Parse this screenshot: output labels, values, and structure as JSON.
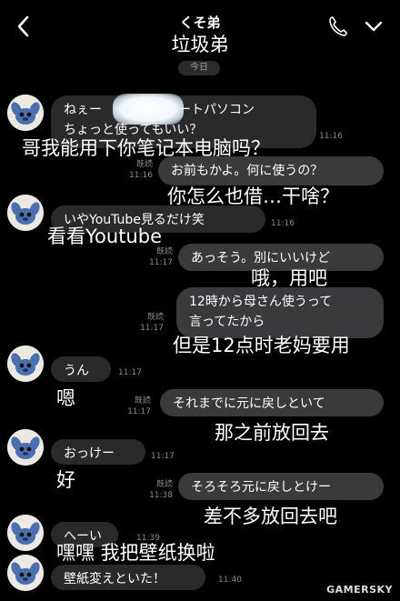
{
  "header": {
    "title": "くそ弟",
    "overlay_title": "垃圾弟"
  },
  "date_label": "今日",
  "messages": [
    {
      "side": "in",
      "lines": [
        "ねぇー　　　　のノートパソコン",
        "ちょっと使ってもいい？"
      ],
      "time": "11:16",
      "read": ""
    },
    {
      "side": "out",
      "lines": [
        "お前もかよ。何に使うの？"
      ],
      "time": "11:16",
      "read": "既読"
    },
    {
      "side": "in",
      "lines": [
        "いやYouTube見るだけ笑"
      ],
      "time": "11:16",
      "read": ""
    },
    {
      "side": "out",
      "lines": [
        "あっそう。別にいいけど"
      ],
      "time": "11:17",
      "read": "既読"
    },
    {
      "side": "out",
      "lines": [
        "12時から母さん使うって",
        "言ってたから"
      ],
      "time": "11:17",
      "read": "既読"
    },
    {
      "side": "in",
      "lines": [
        "うん"
      ],
      "time": "11:17",
      "read": ""
    },
    {
      "side": "out",
      "lines": [
        "それまでに元に戻しといて"
      ],
      "time": "11:17",
      "read": "既読"
    },
    {
      "side": "in",
      "lines": [
        "おっけー"
      ],
      "time": "11:17",
      "read": ""
    },
    {
      "side": "out",
      "lines": [
        "そろそろ元に戻しとけー"
      ],
      "time": "11:38",
      "read": "既読"
    },
    {
      "side": "in",
      "lines": [
        "へーい"
      ],
      "time": "11:39",
      "read": ""
    },
    {
      "side": "in",
      "lines": [
        "壁紙変えといた！"
      ],
      "time": "11:40",
      "read": ""
    }
  ],
  "captions": [
    "哥我能用下你笔记本电脑吗？",
    "你怎么也借…干啥？",
    "看看Youtube",
    "哦，用吧",
    "但是12点时老妈要用",
    "嗯",
    "那之前放回去",
    "好",
    "差不多放回去吧",
    "嘿嘿 我把壁纸换啦"
  ],
  "watermark": "GAMERSKY",
  "colors": {
    "background": "#000000",
    "incoming_bubble": "#2a2a2c",
    "outgoing_bubble": "#3a3a3c",
    "meta_text": "#8a8a8a"
  }
}
